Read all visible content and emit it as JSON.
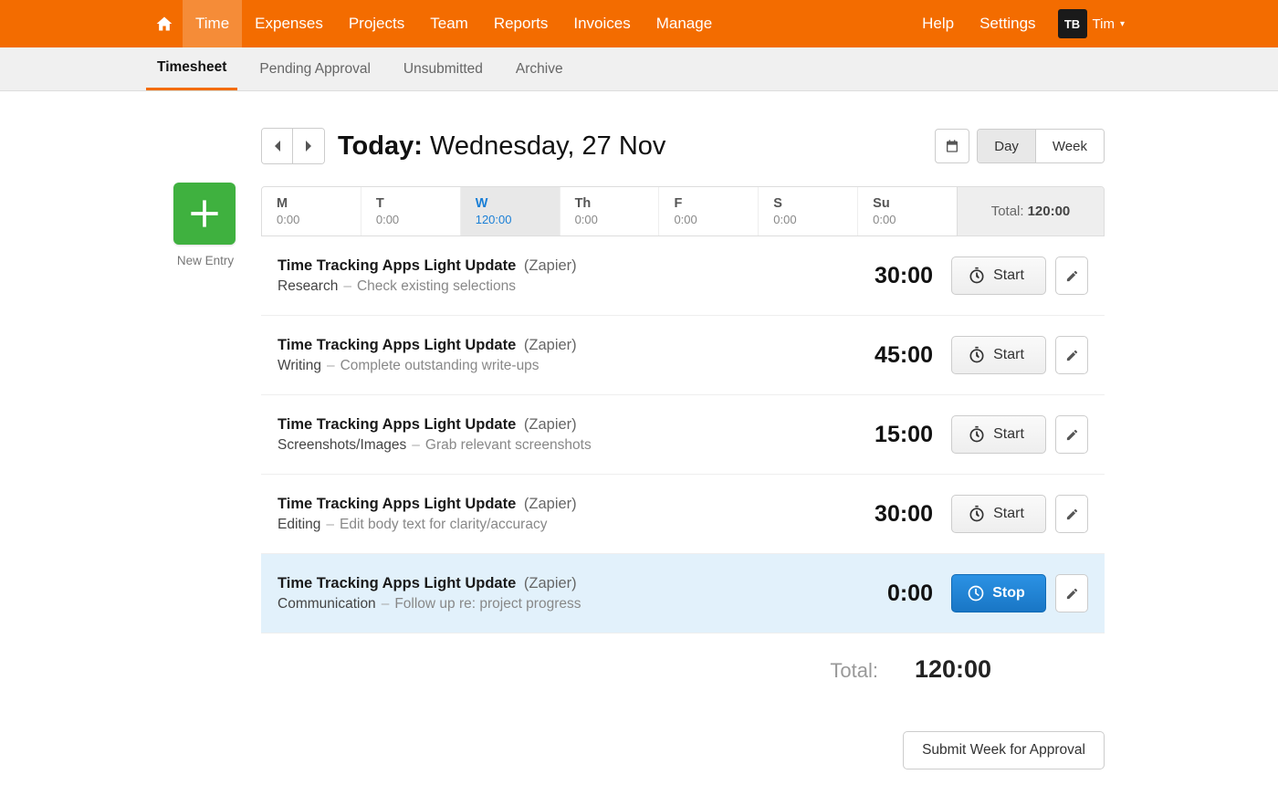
{
  "topnav": {
    "items": [
      "Time",
      "Expenses",
      "Projects",
      "Team",
      "Reports",
      "Invoices",
      "Manage"
    ],
    "active_index": 0,
    "help": "Help",
    "settings": "Settings",
    "avatar_initials": "TB",
    "user_name": "Tim"
  },
  "subnav": {
    "tabs": [
      "Timesheet",
      "Pending Approval",
      "Unsubmitted",
      "Archive"
    ],
    "active_index": 0
  },
  "header": {
    "today_label": "Today:",
    "date_text": "Wednesday, 27 Nov",
    "view_day": "Day",
    "view_week": "Week",
    "active_view": "Day"
  },
  "new_entry_label": "New Entry",
  "week": {
    "days": [
      {
        "abbr": "M",
        "hours": "0:00"
      },
      {
        "abbr": "T",
        "hours": "0:00"
      },
      {
        "abbr": "W",
        "hours": "120:00"
      },
      {
        "abbr": "Th",
        "hours": "0:00"
      },
      {
        "abbr": "F",
        "hours": "0:00"
      },
      {
        "abbr": "S",
        "hours": "0:00"
      },
      {
        "abbr": "Su",
        "hours": "0:00"
      }
    ],
    "active_index": 2,
    "total_label": "Total:",
    "total_value": "120:00"
  },
  "entries": [
    {
      "project": "Time Tracking Apps Light Update",
      "client": "(Zapier)",
      "task": "Research",
      "note": "Check existing selections",
      "time": "30:00",
      "running": false
    },
    {
      "project": "Time Tracking Apps Light Update",
      "client": "(Zapier)",
      "task": "Writing",
      "note": "Complete outstanding write-ups",
      "time": "45:00",
      "running": false
    },
    {
      "project": "Time Tracking Apps Light Update",
      "client": "(Zapier)",
      "task": "Screenshots/Images",
      "note": "Grab relevant screenshots",
      "time": "15:00",
      "running": false
    },
    {
      "project": "Time Tracking Apps Light Update",
      "client": "(Zapier)",
      "task": "Editing",
      "note": "Edit body text for clarity/accuracy",
      "time": "30:00",
      "running": false
    },
    {
      "project": "Time Tracking Apps Light Update",
      "client": "(Zapier)",
      "task": "Communication",
      "note": "Follow up re: project progress",
      "time": "0:00",
      "running": true
    }
  ],
  "buttons": {
    "start": "Start",
    "stop": "Stop"
  },
  "footer": {
    "total_label": "Total:",
    "total_value": "120:00",
    "submit_label": "Submit Week for Approval"
  }
}
